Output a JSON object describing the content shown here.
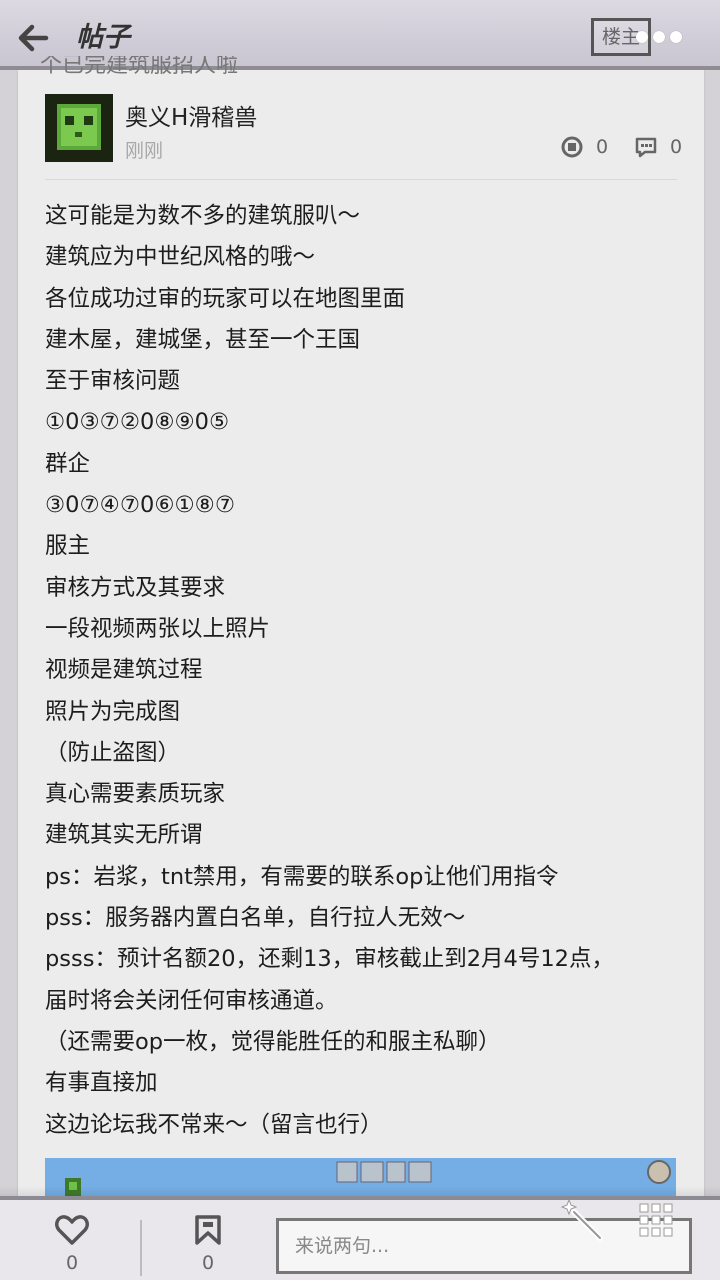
{
  "header": {
    "title": "帖子",
    "op_badge": "楼主",
    "cut_text": "个已完建筑服招人啦"
  },
  "post": {
    "author": "奥义H滑稽兽",
    "time": "刚刚",
    "likes": "0",
    "comments": "0",
    "lines": [
      "这可能是为数不多的建筑服叭～",
      "建筑应为中世纪风格的哦～",
      "各位成功过审的玩家可以在地图里面",
      "建木屋，建城堡，甚至一个王国",
      "至于审核问题",
      "①0③⑦②0⑧⑨0⑤",
      "群企",
      "③0⑦④⑦0⑥①⑧⑦",
      "服主",
      "审核方式及其要求",
      "一段视频两张以上照片",
      "视频是建筑过程",
      "照片为完成图",
      "（防止盗图）",
      "真心需要素质玩家",
      "建筑其实无所谓",
      "ps：岩浆，tnt禁用，有需要的联系op让他们用指令",
      "pss：服务器内置白名单，自行拉人无效～",
      "psss：预计名额20，还剩13，审核截止到2月4号12点，",
      "届时将会关闭任何审核通道。",
      "（还需要op一枚，觉得能胜任的和服主私聊）",
      "有事直接加",
      "这边论坛我不常来～（留言也行）"
    ]
  },
  "bottom": {
    "like_count": "0",
    "fav_count": "0",
    "input_placeholder": "来说两句..."
  },
  "colors": {
    "header_bg": "#cfcbd6",
    "card_bg": "#ececec",
    "image_sky": "#74aee4"
  },
  "icons": [
    "back-arrow-icon",
    "more-dots-icon",
    "like-target-icon",
    "comment-bubble-icon",
    "heart-icon",
    "bookmark-icon",
    "magic-wand-icon",
    "grid-icon"
  ]
}
